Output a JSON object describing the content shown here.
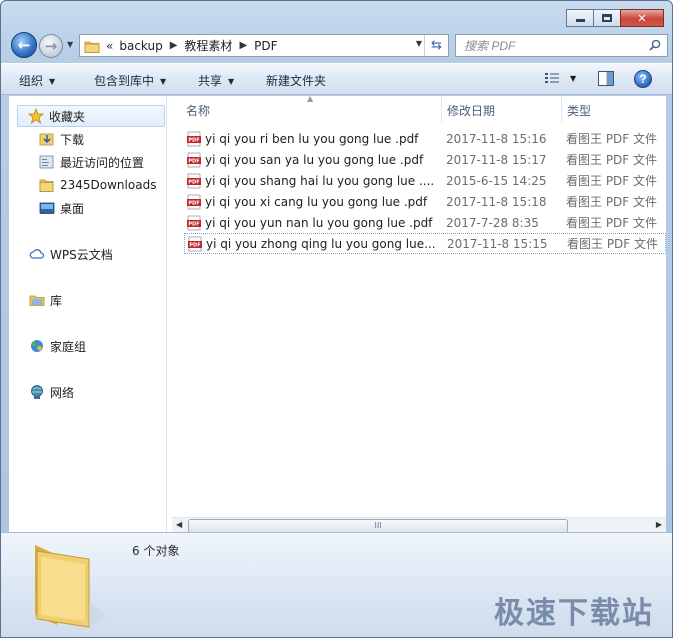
{
  "address": {
    "overflow_chevrons": "«",
    "breadcrumb": [
      "backup",
      "教程素材",
      "PDF"
    ]
  },
  "search": {
    "placeholder": "搜索 PDF"
  },
  "toolbar": {
    "organize": "组织",
    "include_in_library": "包含到库中",
    "share": "共享",
    "new_folder": "新建文件夹"
  },
  "nav": {
    "favorites": "收藏夹",
    "downloads": "下载",
    "recent_places": "最近访问的位置",
    "downloads_2345": "2345Downloads",
    "desktop": "桌面",
    "wps_cloud": "WPS云文档",
    "libraries": "库",
    "homegroup": "家庭组",
    "network": "网络"
  },
  "columns": {
    "name": "名称",
    "date_modified": "修改日期",
    "type": "类型"
  },
  "files": [
    {
      "name": "yi qi you ri ben lu you gong lue .pdf",
      "date": "2017-11-8 15:16",
      "type": "看图王 PDF 文件"
    },
    {
      "name": "yi qi you san ya lu you gong lue .pdf",
      "date": "2017-11-8 15:17",
      "type": "看图王 PDF 文件"
    },
    {
      "name": "yi qi you shang hai lu you gong lue ....",
      "date": "2015-6-15 14:25",
      "type": "看图王 PDF 文件"
    },
    {
      "name": "yi qi you xi cang lu you gong lue .pdf",
      "date": "2017-11-8 15:18",
      "type": "看图王 PDF 文件"
    },
    {
      "name": "yi qi you yun nan lu you gong lue .pdf",
      "date": "2017-7-28 8:35",
      "type": "看图王 PDF 文件"
    },
    {
      "name": "yi qi you zhong qing lu you gong lue...",
      "date": "2017-11-8 15:15",
      "type": "看图王 PDF 文件"
    }
  ],
  "status": {
    "item_count": "6 个对象"
  },
  "watermark": "极速下载站",
  "colors": {
    "selection_border": "#7ca1d2",
    "chrome": "#c9dbee",
    "pdf_red": "#c0262d"
  }
}
